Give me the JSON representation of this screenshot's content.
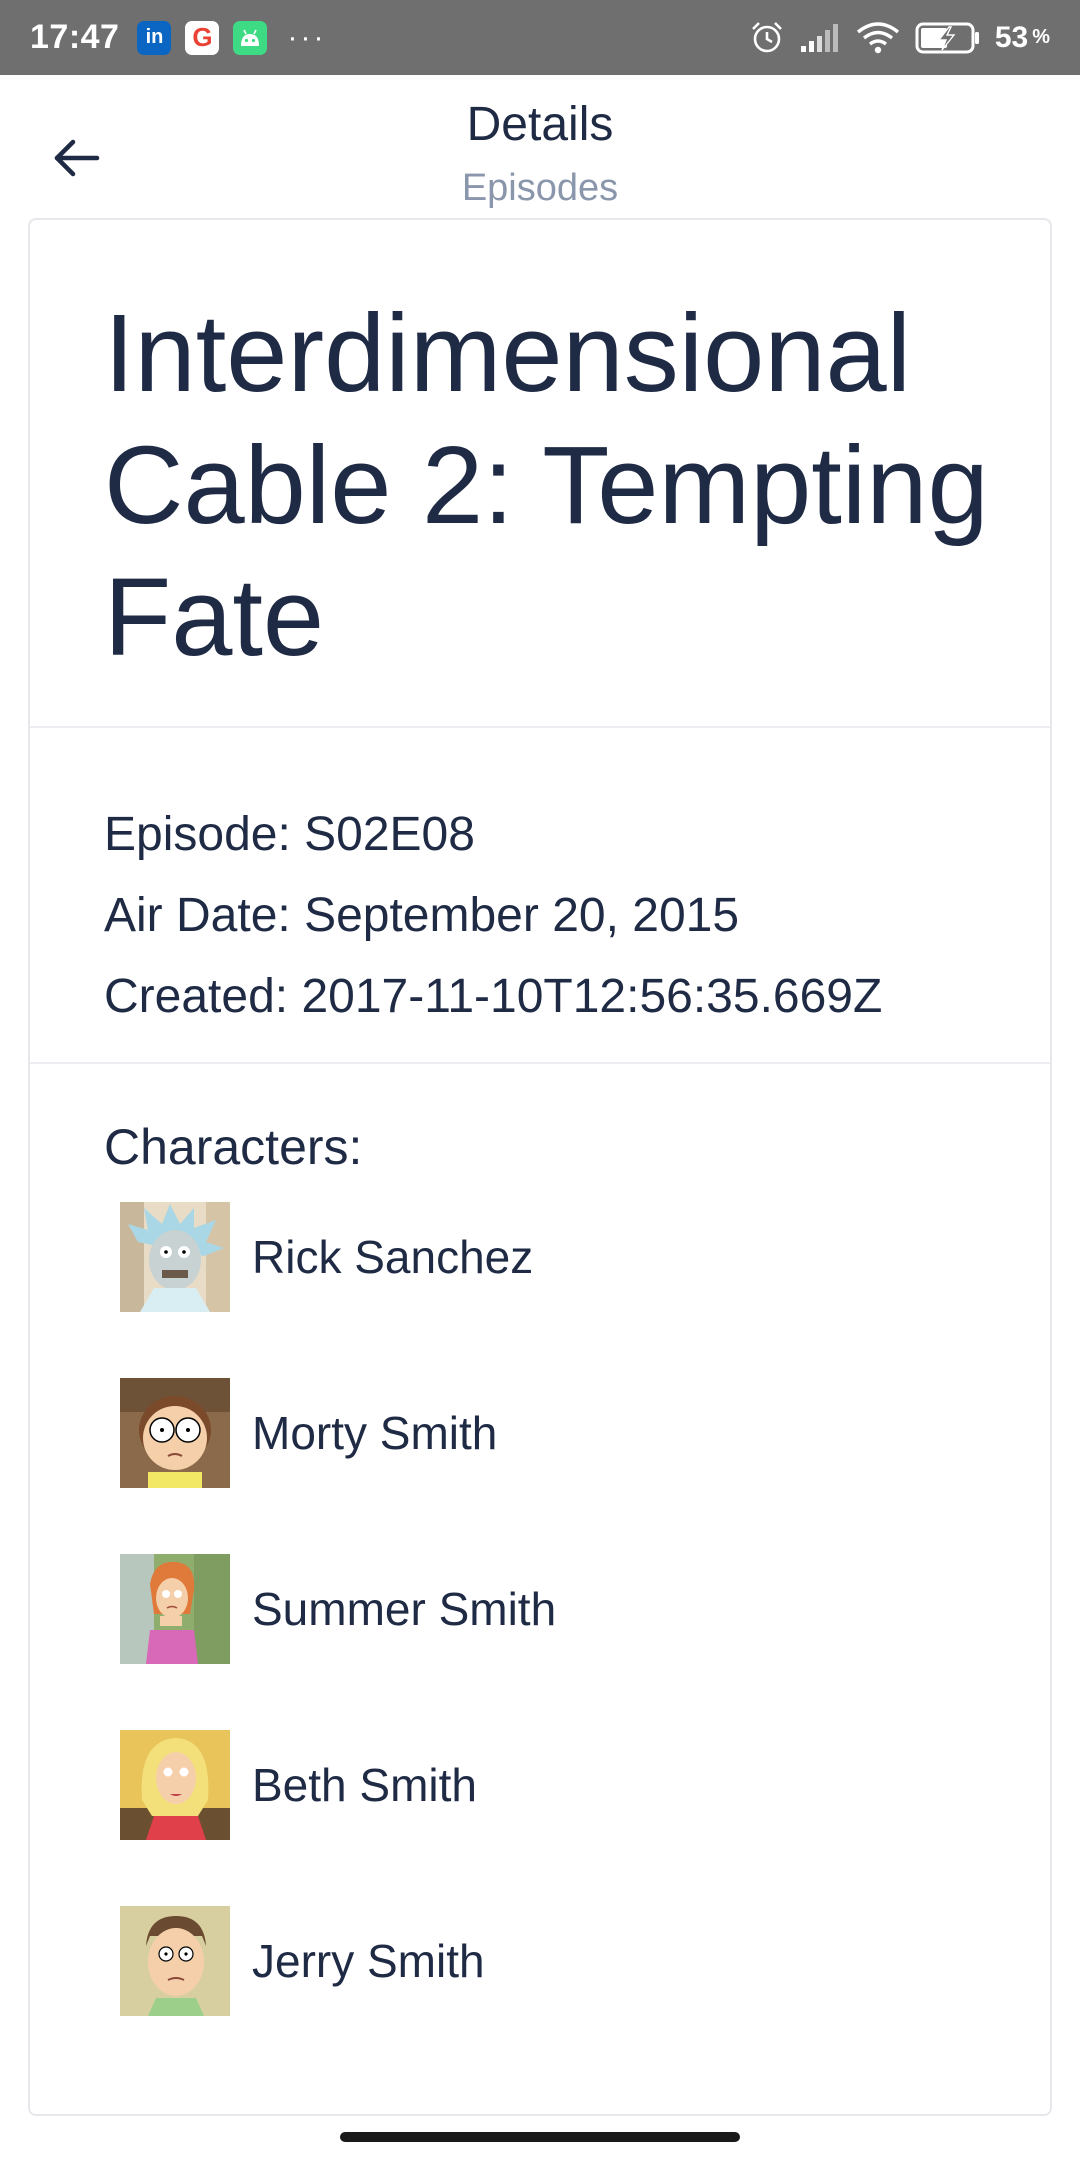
{
  "status_bar": {
    "time": "17:47",
    "apps": [
      "linkedin-icon",
      "google-icon",
      "android-icon"
    ],
    "more": "···",
    "battery_percent": "53",
    "battery_unit": "%"
  },
  "header": {
    "title": "Details",
    "subtitle": "Episodes"
  },
  "episode": {
    "name": "Interdimensional Cable 2: Tempting Fate",
    "episode_line": "Episode: S02E08",
    "air_date_line": "Air Date: September 20, 2015",
    "created_line": "Created: 2017-11-10T12:56:35.669Z"
  },
  "characters": {
    "heading": "Characters:",
    "items": [
      {
        "name": "Rick Sanchez",
        "avatar": "rick-avatar"
      },
      {
        "name": "Morty Smith",
        "avatar": "morty-avatar"
      },
      {
        "name": "Summer Smith",
        "avatar": "summer-avatar"
      },
      {
        "name": "Beth Smith",
        "avatar": "beth-avatar"
      },
      {
        "name": "Jerry Smith",
        "avatar": "jerry-avatar"
      }
    ]
  },
  "colors": {
    "text_primary": "#1f2a44",
    "text_secondary": "#8a96ab",
    "status_bar": "#6f6f6f",
    "divider": "#eceef1"
  }
}
